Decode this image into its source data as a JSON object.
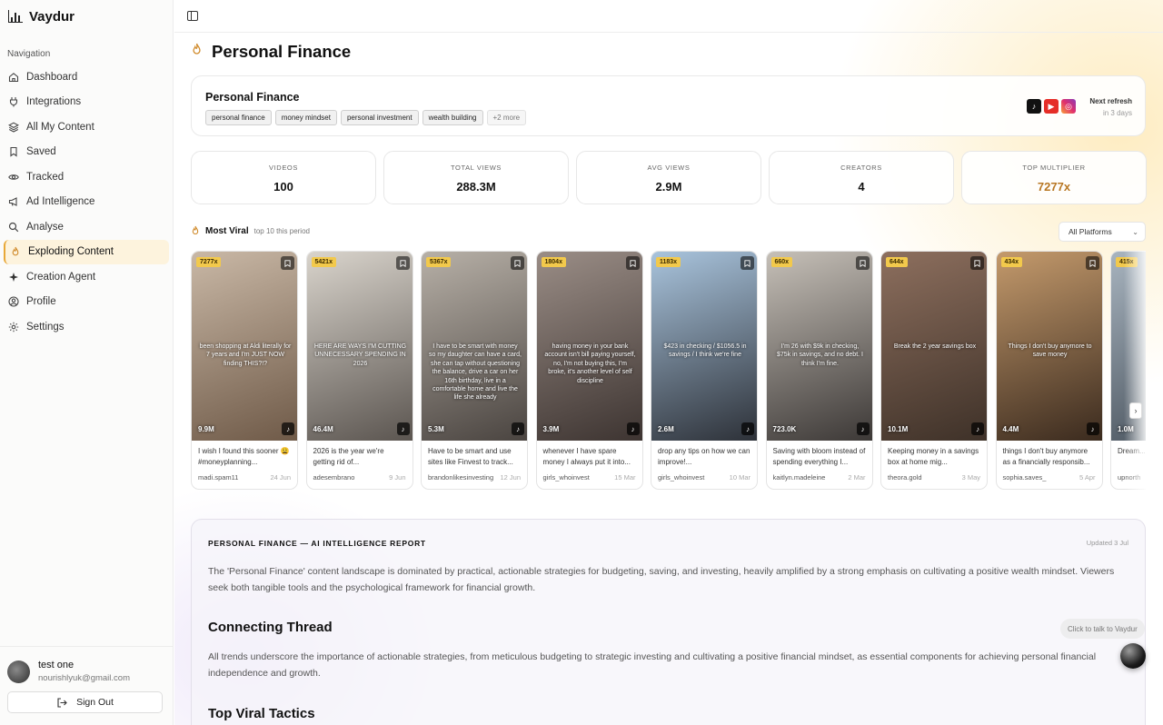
{
  "brand": {
    "name": "Vaydur"
  },
  "nav": {
    "caption": "Navigation",
    "items": [
      {
        "label": "Dashboard",
        "icon": "home-icon"
      },
      {
        "label": "Integrations",
        "icon": "plug-icon"
      },
      {
        "label": "All My Content",
        "icon": "layers-icon"
      },
      {
        "label": "Saved",
        "icon": "bookmark-icon"
      },
      {
        "label": "Tracked",
        "icon": "eye-icon"
      },
      {
        "label": "Ad Intelligence",
        "icon": "megaphone-icon"
      },
      {
        "label": "Analyse",
        "icon": "search-icon"
      },
      {
        "label": "Exploding Content",
        "icon": "flame-icon",
        "active": true
      },
      {
        "label": "Creation Agent",
        "icon": "sparkle-icon"
      },
      {
        "label": "Profile",
        "icon": "user-circle-icon"
      },
      {
        "label": "Settings",
        "icon": "gear-icon"
      }
    ]
  },
  "user": {
    "name": "test one",
    "email": "nourishlyuk@gmail.com",
    "signout_label": "Sign Out"
  },
  "page": {
    "title": "Personal Finance"
  },
  "topic": {
    "title": "Personal Finance",
    "tags": [
      "personal finance",
      "money mindset",
      "personal investment",
      "wealth building"
    ],
    "more_tags": "+2 more",
    "platforms": [
      "tiktok-icon",
      "youtube-icon",
      "instagram-icon"
    ],
    "refresh_label": "Next refresh",
    "refresh_value": "in 3 days"
  },
  "stats": [
    {
      "label": "VIDEOS",
      "value": "100"
    },
    {
      "label": "TOTAL VIEWS",
      "value": "288.3M"
    },
    {
      "label": "AVG VIEWS",
      "value": "2.9M"
    },
    {
      "label": "CREATORS",
      "value": "4"
    },
    {
      "label": "TOP MULTIPLIER",
      "value": "7277x"
    }
  ],
  "viral": {
    "title": "Most Viral",
    "subtitle": "top 10 this period",
    "platform_filter": "All Platforms"
  },
  "videos": [
    {
      "multiplier": "7277x",
      "views": "9.9M",
      "caption": "I wish I found this sooner 😩 #moneyplanning...",
      "author": "madi.spam11",
      "date": "24 Jun",
      "overlay": "been shopping at Aldi literally for 7 years and I'm JUST NOW finding THIS?!?",
      "bg": [
        "#c9b8a6",
        "#6f5a48"
      ]
    },
    {
      "multiplier": "5421x",
      "views": "46.4M",
      "caption": "2026 is the year we're getting rid of...",
      "author": "adesembrano",
      "date": "9 Jun",
      "overlay": "HERE ARE WAYS I'M CUTTING UNNECESSARY SPENDING IN 2026",
      "bg": [
        "#d9d4cc",
        "#5b5550"
      ]
    },
    {
      "multiplier": "5367x",
      "views": "5.3M",
      "caption": "Have to be smart and use sites like Finvest to track...",
      "author": "brandonlikesinvesting",
      "date": "12 Jun",
      "overlay": "I have to be smart with money so my daughter can have a card, she can tap without questioning the balance, drive a car on her 16th birthday, live in a comfortable home and live the life she already",
      "bg": [
        "#b7b0a7",
        "#4a4440"
      ]
    },
    {
      "multiplier": "1804x",
      "views": "3.9M",
      "caption": "whenever I have spare money I always put it into...",
      "author": "girls_whoinvest",
      "date": "15 Mar",
      "overlay": "having money in your bank account isn't bill paying yourself, no, I'm not buying this, I'm broke, it's another level of self discipline",
      "bg": [
        "#9a8d86",
        "#3d3431"
      ]
    },
    {
      "multiplier": "1183x",
      "views": "2.6M",
      "caption": "drop any tips on how we can improve!...",
      "author": "girls_whoinvest",
      "date": "10 Mar",
      "overlay": "$423 in checking / $1056.5 in savings / I think we're fine",
      "bg": [
        "#a9c4dd",
        "#2d3138"
      ]
    },
    {
      "multiplier": "660x",
      "views": "723.0K",
      "caption": "Saving with bloom instead of spending everything I...",
      "author": "kaitlyn.madeleine",
      "date": "2 Mar",
      "overlay": "I'm 26 with $9k in checking, $75k in savings, and no debt. I think I'm fine.",
      "bg": [
        "#c6c0b8",
        "#3c3836"
      ]
    },
    {
      "multiplier": "644x",
      "views": "10.1M",
      "caption": "Keeping money in a savings box at home mig...",
      "author": "theora.gold",
      "date": "3 May",
      "overlay": "Break the 2 year savings box",
      "bg": [
        "#8d6f5e",
        "#3e3128"
      ]
    },
    {
      "multiplier": "434x",
      "views": "4.4M",
      "caption": "things I don't buy anymore as a financially responsib...",
      "author": "sophia.saves_",
      "date": "5 Apr",
      "overlay": "Things I don't buy anymore to save money",
      "bg": [
        "#c49a6c",
        "#3a2a1e"
      ]
    },
    {
      "multiplier": "415x",
      "views": "1.0M",
      "caption": "Dream... how do...",
      "author": "upnorth",
      "date": "",
      "overlay": "",
      "bg": [
        "#a8b4bf",
        "#48525c"
      ]
    }
  ],
  "report": {
    "title": "PERSONAL FINANCE — AI INTELLIGENCE REPORT",
    "updated": "Updated 3 Jul",
    "summary": "The 'Personal Finance' content landscape is dominated by practical, actionable strategies for budgeting, saving, and investing, heavily amplified by a strong emphasis on cultivating a positive wealth mindset. Viewers seek both tangible tools and the psychological framework for financial growth.",
    "section1_title": "Connecting Thread",
    "section1_text": "All trends underscore the importance of actionable strategies, from meticulous budgeting to strategic investing and cultivating a positive financial mindset, as essential components for achieving personal financial independence and growth.",
    "section2_title": "Top Viral Tactics"
  },
  "assistant": {
    "talk_label": "Click to talk to Vaydur"
  }
}
